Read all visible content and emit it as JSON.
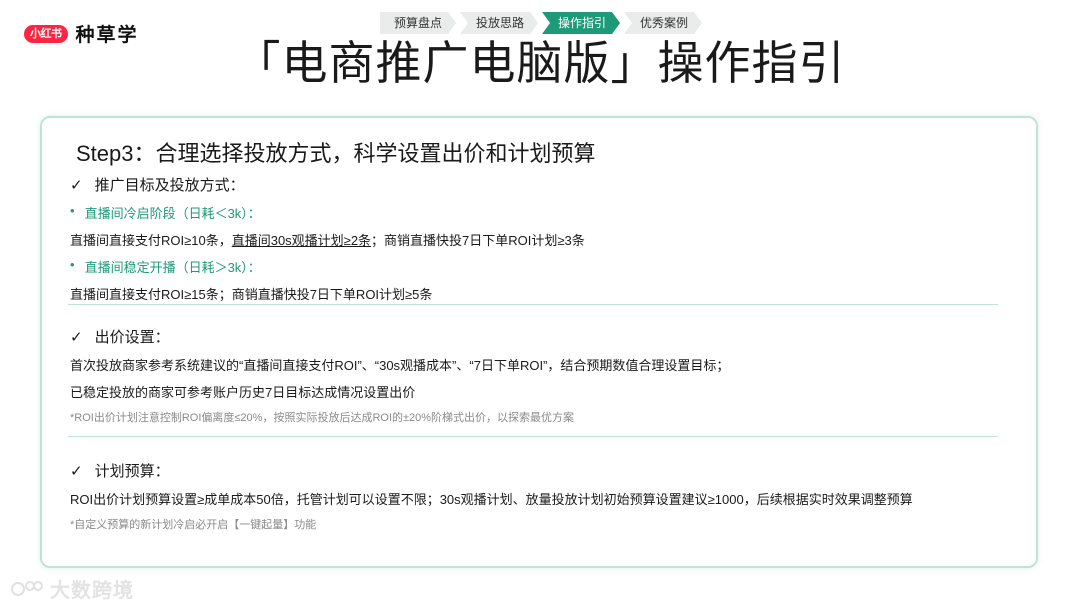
{
  "logo": {
    "badge": "小红书",
    "name": "种草学"
  },
  "steps": [
    "预算盘点",
    "投放思路",
    "操作指引",
    "优秀案例"
  ],
  "active_step": 2,
  "title": "「电商推广电脑版」操作指引",
  "card": {
    "heading": "Step3：合理选择投放方式，科学设置出价和计划预算",
    "sections": {
      "s1": {
        "check": "✓",
        "title": "推广目标及投放方式：",
        "item1_bullet": "•",
        "item1": "直播间冷启阶段（日耗＜3k）：",
        "line1_a": "直播间直接支付ROI≥10条，",
        "line1_b": "直播间30s观播计划≥2条",
        "line1_c": "；商销直播快投7日下单ROI计划≥3条",
        "item2_bullet": "•",
        "item2": "直播间稳定开播（日耗＞3k）：",
        "line2": "直播间直接支付ROI≥15条；商销直播快投7日下单ROI计划≥5条"
      },
      "s2": {
        "check": "✓",
        "title": "出价设置：",
        "line1": "首次投放商家参考系统建议的“直播间直接支付ROI”、“30s观播成本”、“7日下单ROI”，结合预期数值合理设置目标；",
        "line2": "已稳定投放的商家可参考账户历史7日目标达成情况设置出价",
        "note": "*ROI出价计划注意控制ROI偏离度≤20%，按照实际投放后达成ROI的±20%阶梯式出价，以探索最优方案"
      },
      "s3": {
        "check": "✓",
        "title": "计划预算：",
        "line1": "ROI出价计划预算设置≥成单成本50倍，托管计划可以设置不限；30s观播计划、放量投放计划初始预算设置建议≥1000，后续根据实时效果调整预算",
        "note": "*自定义预算的新计划冷启必开启【一键起量】功能"
      }
    }
  },
  "watermark": "大数跨境",
  "colors": {
    "accent": "#1f9a78",
    "brand": "#ff2442",
    "border": "#bfe3d8"
  }
}
